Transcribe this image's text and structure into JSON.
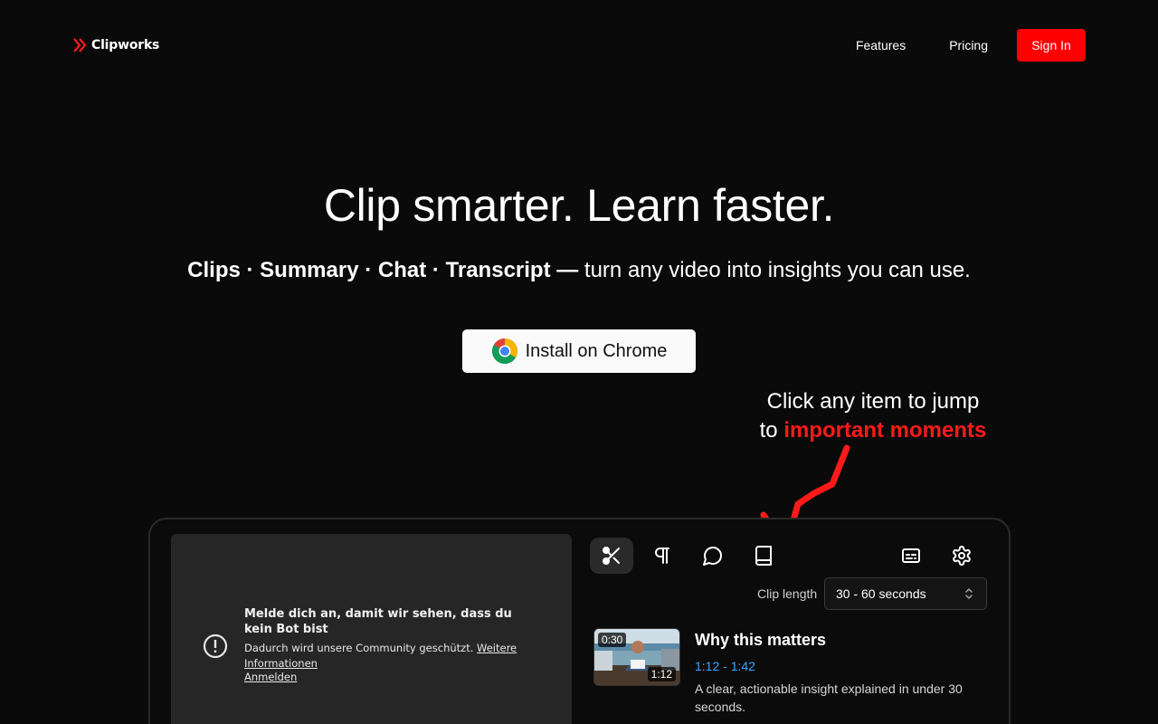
{
  "brand": {
    "name": "Clipworks",
    "accent": "#ff0000"
  },
  "nav": {
    "features": "Features",
    "pricing": "Pricing",
    "signin": "Sign In"
  },
  "hero": {
    "title": "Clip smarter. Learn faster.",
    "sub_bold": "Clips · Summary · Chat · Transcript —",
    "sub_rest": " turn any video into insights you can use.",
    "install_label": "Install on Chrome"
  },
  "callout": {
    "line1": "Click any item to jump",
    "line2_prefix": "to ",
    "highlight": "important moments"
  },
  "video_notice": {
    "title": "Melde dich an, damit wir sehen, dass du kein Bot bist",
    "desc": "Dadurch wird unsere Community geschützt.",
    "more": "Weitere Informationen",
    "signin": "Anmelden"
  },
  "tools": [
    {
      "name": "scissors-icon",
      "active": true
    },
    {
      "name": "paragraph-icon",
      "active": false
    },
    {
      "name": "chat-bubble-icon",
      "active": false
    },
    {
      "name": "book-icon",
      "active": false
    },
    {
      "name": "captions-icon",
      "active": false
    },
    {
      "name": "gear-icon",
      "active": false
    }
  ],
  "clip_length": {
    "label": "Clip length",
    "selected": "30 - 60 seconds"
  },
  "clip": {
    "duration": "0:30",
    "timestamp": "1:12",
    "title": "Why this matters",
    "range": "1:12 - 1:42",
    "desc": "A clear, actionable insight explained in under 30 seconds."
  }
}
